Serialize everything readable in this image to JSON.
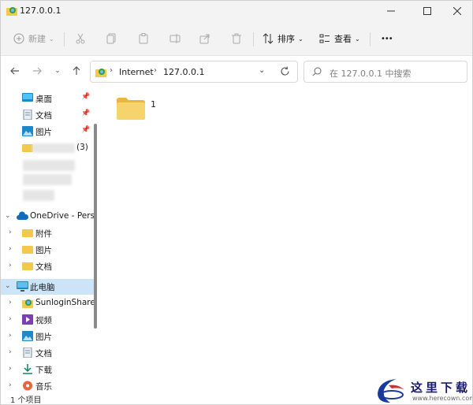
{
  "window": {
    "title": "127.0.0.1"
  },
  "toolbar": {
    "new_label": "新建",
    "sort_label": "排序",
    "view_label": "查看",
    "more_label": "•••"
  },
  "address": {
    "parts": [
      "Internet",
      "127.0.0.1"
    ]
  },
  "search": {
    "placeholder": "在 127.0.0.1 中搜索"
  },
  "sidebar": {
    "quick": [
      {
        "label": "桌面"
      },
      {
        "label": "文档"
      },
      {
        "label": "图片"
      },
      {
        "label": "(3)"
      }
    ],
    "onedrive": {
      "label": "OneDrive - Perso"
    },
    "onedrive_children": [
      {
        "label": "附件"
      },
      {
        "label": "图片"
      },
      {
        "label": "文档"
      }
    ],
    "this_pc": {
      "label": "此电脑"
    },
    "pc_children": [
      {
        "label": "SunloginShare("
      },
      {
        "label": "视频"
      },
      {
        "label": "图片"
      },
      {
        "label": "文档"
      },
      {
        "label": "下载"
      },
      {
        "label": "音乐"
      }
    ]
  },
  "files": [
    {
      "name": "1"
    }
  ],
  "status": {
    "text": "1 个项目"
  },
  "watermark": {
    "text": "这里下载",
    "url": "www.herecown.com"
  },
  "colors": {
    "selected": "#cce4f7",
    "folder": "#f2c94c",
    "accent": "#0067c0"
  }
}
